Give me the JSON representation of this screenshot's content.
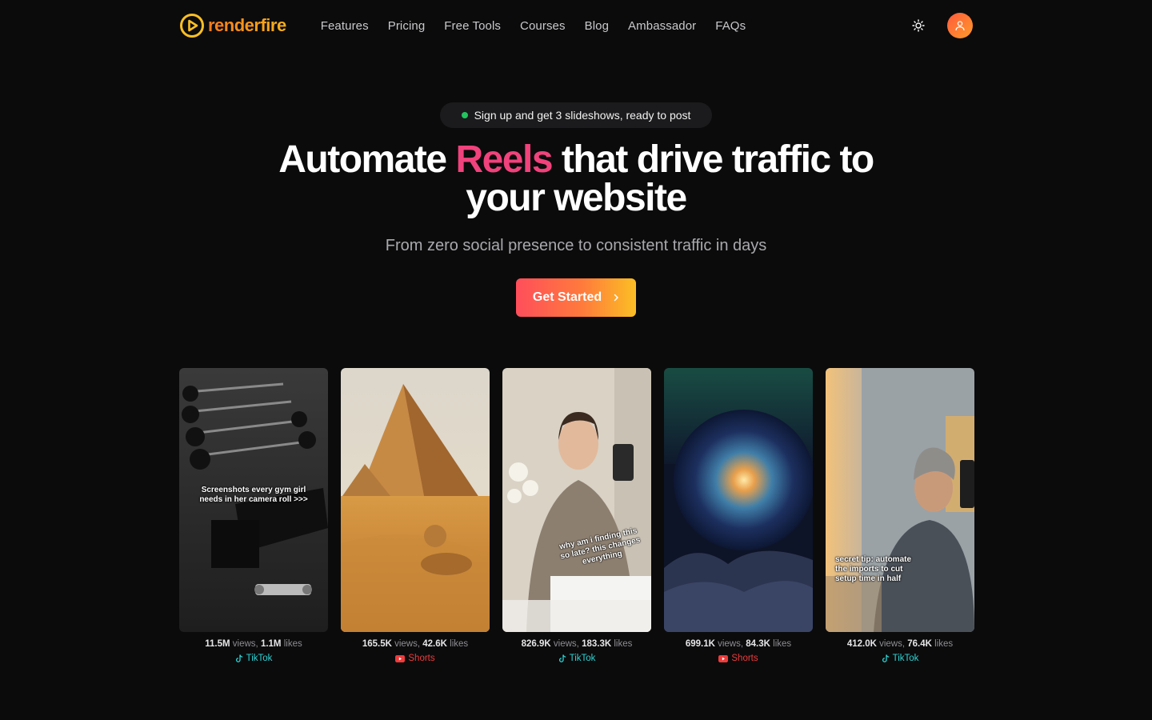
{
  "brand": {
    "name": "renderfire",
    "accent": "#ff7a1a"
  },
  "nav": {
    "items": [
      {
        "label": "Features"
      },
      {
        "label": "Pricing"
      },
      {
        "label": "Free Tools"
      },
      {
        "label": "Courses"
      },
      {
        "label": "Blog"
      },
      {
        "label": "Ambassador"
      },
      {
        "label": "FAQs"
      }
    ],
    "theme_icon": "sun-icon",
    "user_icon": "user-icon"
  },
  "hero": {
    "badge": "Sign up and get 3 slideshows, ready to post",
    "headline_pre": "Automate ",
    "headline_accent": "Reels",
    "headline_post": " that drive traffic to your website",
    "accent_color": "#f0427c",
    "subheadline": "From zero social presence to consistent traffic in days",
    "cta_label": "Get Started"
  },
  "examples": [
    {
      "caption": "Screenshots every gym girl needs in her camera roll >>>",
      "views": "11.5M",
      "likes": "1.1M",
      "platform": "TikTok",
      "platform_icon": "tiktok-icon"
    },
    {
      "caption": "",
      "views": "165.5K",
      "likes": "42.6K",
      "platform": "Shorts",
      "platform_icon": "youtube-icon"
    },
    {
      "caption": "why am i finding this so late? this changes everything",
      "views": "826.9K",
      "likes": "183.3K",
      "platform": "TikTok",
      "platform_icon": "tiktok-icon"
    },
    {
      "caption": "",
      "views": "699.1K",
      "likes": "84.3K",
      "platform": "Shorts",
      "platform_icon": "youtube-icon"
    },
    {
      "caption": "secret tip: automate the imports to cut setup time in half",
      "views": "412.0K",
      "likes": "76.4K",
      "platform": "TikTok",
      "platform_icon": "tiktok-icon"
    }
  ],
  "labels": {
    "views": "views",
    "likes": "likes"
  }
}
